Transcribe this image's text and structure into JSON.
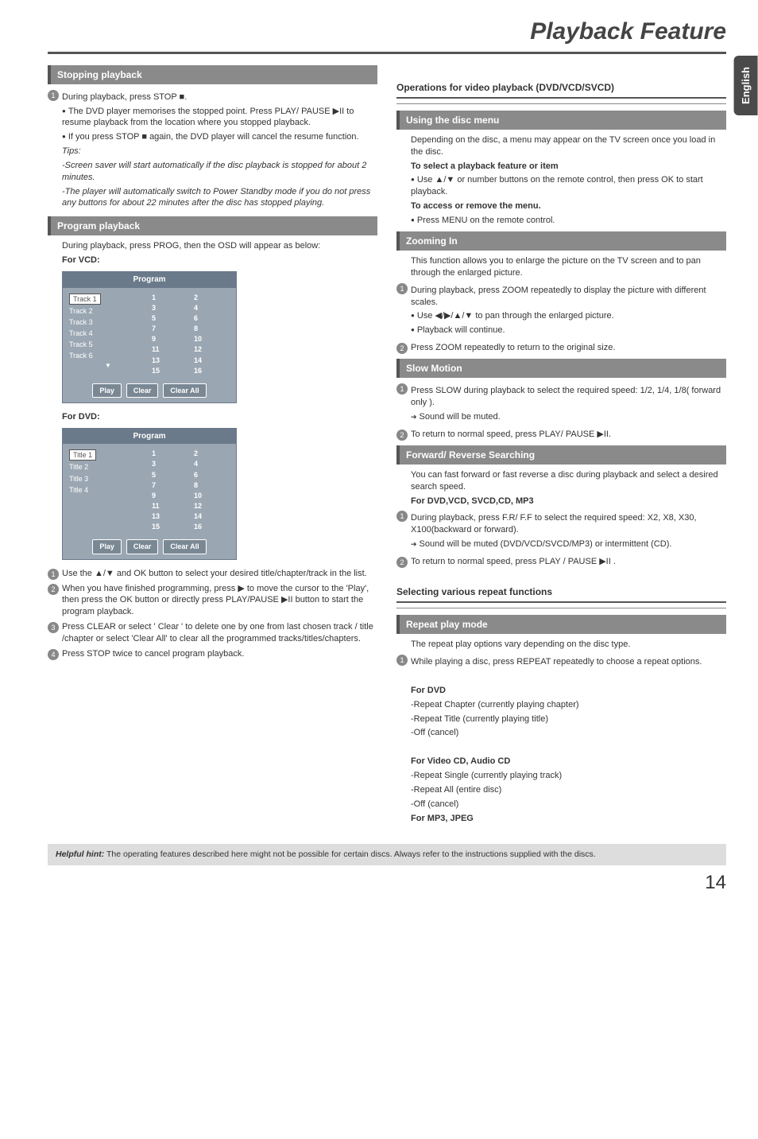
{
  "chapter_title": "Playback Feature",
  "lang_tab": "English",
  "left": {
    "stopping_bar": "Stopping playback",
    "stop_step1": "During playback, press STOP ■.",
    "stop_b1": "The DVD player memorises the stopped point. Press PLAY/ PAUSE ▶II to resume playback from the location where you stopped playback.",
    "stop_b2": "If you press STOP ■ again, the DVD player will cancel the resume function.",
    "tips_label": "Tips:",
    "tips1": "-Screen saver will start automatically if the disc playback is stopped for about 2 minutes.",
    "tips2": "-The player will automatically switch to Power Standby mode if you do not press any buttons for about 22 minutes after the disc has stopped playing.",
    "program_bar": "Program playback",
    "program_intro": "During playback, press  PROG, then the OSD will appear as below:",
    "for_vcd": "For VCD:",
    "for_dvd": "For DVD:",
    "osd_program": "Program",
    "vcd_tracks": [
      "Track 1",
      "Track 2",
      "Track 3",
      "Track 4",
      "Track 5",
      "Track 6"
    ],
    "dvd_titles": [
      "Title 1",
      "Title 2",
      "Title 3",
      "Title 4"
    ],
    "nums": [
      "1",
      "2",
      "3",
      "4",
      "5",
      "6",
      "7",
      "8",
      "9",
      "10",
      "11",
      "12",
      "13",
      "14",
      "15",
      "16"
    ],
    "btn_play": "Play",
    "btn_clear": "Clear",
    "btn_clearall": "Clear All",
    "prog_s1": "Use the ▲/▼ and OK button to select your desired title/chapter/track in the list.",
    "prog_s2": "When you have finished programming, press ▶ to move the cursor to the 'Play', then press the OK button or directly press PLAY/PAUSE ▶II button to start the program playback.",
    "prog_s3": "Press CLEAR or select ' Clear ' to delete one by one from last chosen track / title /chapter or select 'Clear All' to clear all the programmed tracks/titles/chapters.",
    "prog_s4": "Press STOP twice to cancel program playback."
  },
  "right": {
    "ops_head": "Operations for video playback (DVD/VCD/SVCD)",
    "using_menu_bar": "Using the disc menu",
    "menu_p1": "Depending on the disc, a menu may appear on the TV screen once you load in the disc.",
    "menu_h1": "To select a playback feature or item",
    "menu_b1": "Use ▲/▼ or number buttons on the remote control, then press OK to start playback.",
    "menu_h2": "To access or remove the menu.",
    "menu_b2": "Press MENU on the remote control.",
    "zoom_bar": "Zooming In",
    "zoom_p1": "This function allows you to enlarge the picture on the TV screen and to pan through the enlarged picture.",
    "zoom_s1": "During playback, press ZOOM repeatedly to display the picture with different scales.",
    "zoom_b1": "Use ◀/▶/▲/▼ to pan through the enlarged picture.",
    "zoom_b2": "Playback will continue.",
    "zoom_s2": "Press ZOOM repeatedly to return to the original size.",
    "slow_bar": "Slow Motion",
    "slow_s1": "Press SLOW during playback to select the required speed: 1/2, 1/4, 1/8( forward only ).",
    "slow_a1": "Sound will be muted.",
    "slow_s2": "To return to normal speed, press PLAY/ PAUSE ▶II.",
    "fr_bar": "Forward/ Reverse Searching",
    "fr_p1": "You can fast forward or fast reverse a disc during playback and select a desired search speed.",
    "fr_for": "For  DVD,VCD, SVCD,CD, MP3",
    "fr_s1": "During playback, press F.R/ F.F to select the required speed: X2, X8, X30, X100(backward or forward).",
    "fr_a1": "Sound will be muted (DVD/VCD/SVCD/MP3) or intermittent (CD).",
    "fr_s2": "To return to normal speed, press PLAY / PAUSE ▶II .",
    "sel_head": "Selecting various repeat functions",
    "repeat_bar": "Repeat play mode",
    "repeat_p1": "The repeat play options vary depending on the disc type.",
    "repeat_s1": "While playing a disc, press REPEAT repeatedly to choose a repeat options.",
    "for_dvd_h": "For DVD",
    "dvd_r1": "-Repeat Chapter (currently playing chapter)",
    "dvd_r2": "-Repeat Title (currently playing title)",
    "dvd_r3": "-Off (cancel)",
    "for_vcd_h": "For Video CD, Audio CD",
    "vcd_r1": "-Repeat Single (currently playing track)",
    "vcd_r2": "-Repeat All (entire disc)",
    "vcd_r3": "-Off (cancel)",
    "for_mp3_h": "For MP3, JPEG"
  },
  "hint_label": "Helpful hint:",
  "hint_text": " The operating features described here might not be possible for certain discs. Always refer to the instructions  supplied with the discs.",
  "page_num": "14"
}
